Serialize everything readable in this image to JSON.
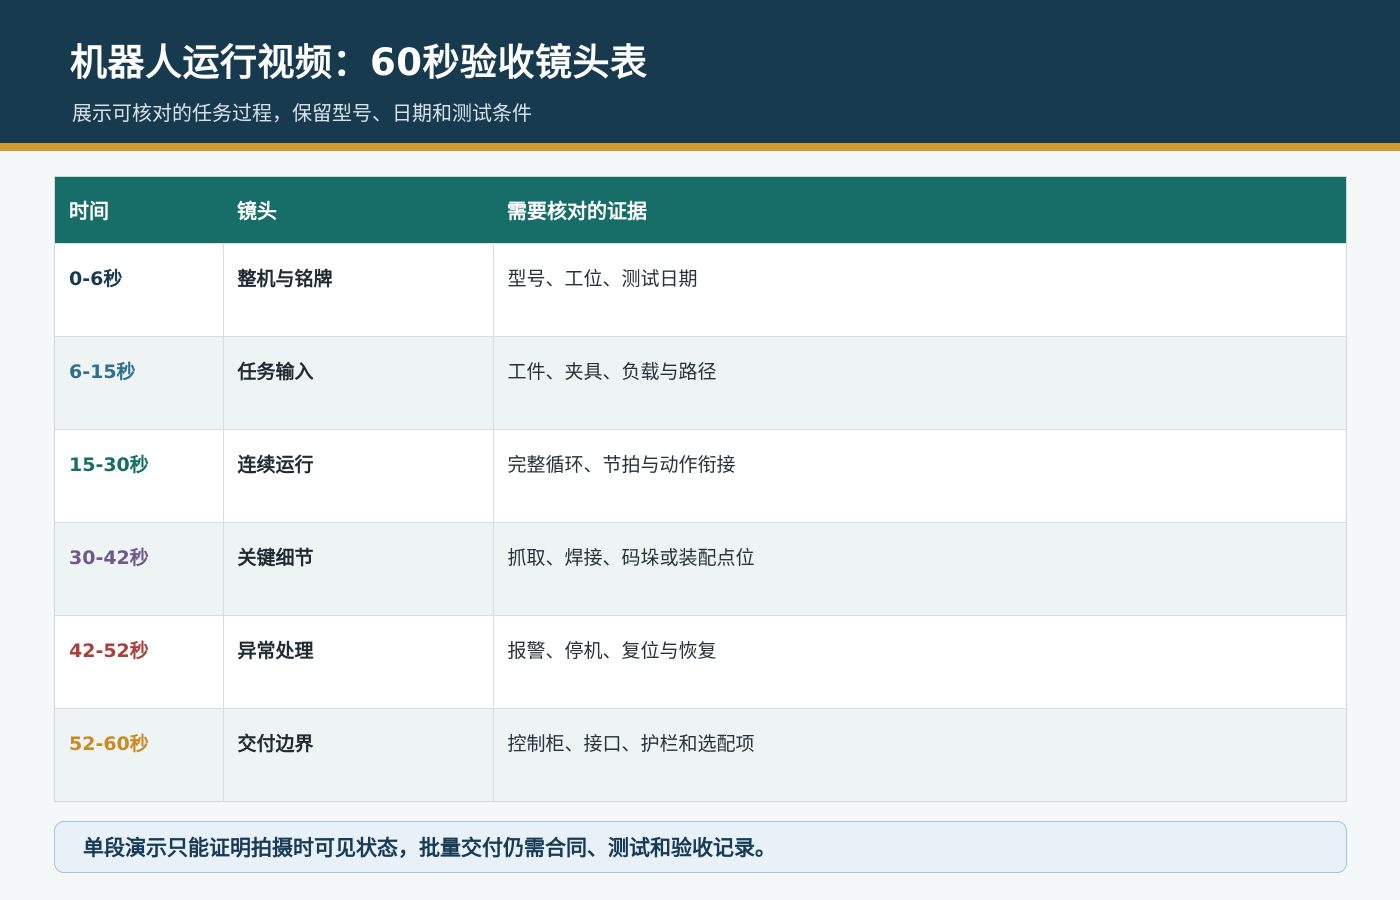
{
  "header": {
    "title": "机器人运行视频：60秒验收镜头表",
    "subtitle": "展示可核对的任务过程，保留型号、日期和测试条件"
  },
  "table": {
    "columns": [
      "时间",
      "镜头",
      "需要核对的证据"
    ],
    "rows": [
      {
        "time": "0-6秒",
        "shot": "整机与铭牌",
        "evidence": "型号、工位、测试日期",
        "time_color": "#183a4f"
      },
      {
        "time": "6-15秒",
        "shot": "任务输入",
        "evidence": "工件、夹具、负载与路径",
        "time_color": "#2f6f91"
      },
      {
        "time": "15-30秒",
        "shot": "连续运行",
        "evidence": "完整循环、节拍与动作衔接",
        "time_color": "#176d67"
      },
      {
        "time": "30-42秒",
        "shot": "关键细节",
        "evidence": "抓取、焊接、码垛或装配点位",
        "time_color": "#6e5a8a"
      },
      {
        "time": "42-52秒",
        "shot": "异常处理",
        "evidence": "报警、停机、复位与恢复",
        "time_color": "#a8413b"
      },
      {
        "time": "52-60秒",
        "shot": "交付边界",
        "evidence": "控制柜、接口、护栏和选配项",
        "time_color": "#c98a23"
      }
    ]
  },
  "note": {
    "text": "单段演示只能证明拍摄时可见状态，批量交付仍需合同、测试和验收记录。"
  },
  "colors": {
    "header_bg": "#183a4f",
    "accent": "#d39a32",
    "table_header_bg": "#176d67"
  }
}
